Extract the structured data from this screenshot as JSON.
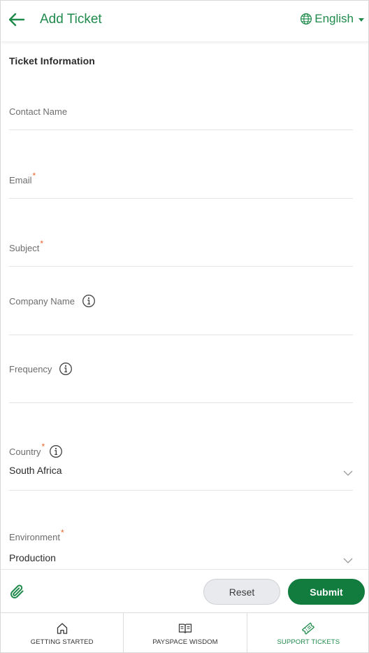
{
  "header": {
    "title": "Add Ticket",
    "language": "English"
  },
  "form": {
    "section_title": "Ticket Information",
    "required_marker": "*",
    "fields": {
      "contact_name": {
        "label": "Contact Name",
        "value": ""
      },
      "email": {
        "label": "Email",
        "value": ""
      },
      "subject": {
        "label": "Subject",
        "value": ""
      },
      "company_name": {
        "label": "Company Name",
        "value": ""
      },
      "frequency": {
        "label": "Frequency",
        "value": ""
      },
      "country": {
        "label": "Country",
        "value": "South Africa"
      },
      "environment": {
        "label": "Environment",
        "value": "Production"
      }
    }
  },
  "actions": {
    "reset_label": "Reset",
    "submit_label": "Submit"
  },
  "bottom_nav": {
    "items": [
      {
        "label": "GETTING STARTED",
        "icon": "home-icon",
        "active": false
      },
      {
        "label": "PAYSPACE WISDOM",
        "icon": "book-icon",
        "active": false
      },
      {
        "label": "SUPPORT TICKETS",
        "icon": "ticket-icon",
        "active": true
      }
    ]
  },
  "colors": {
    "brand_green": "#1f8a4c",
    "submit_green": "#117c3e",
    "required_orange": "#e8632b"
  }
}
